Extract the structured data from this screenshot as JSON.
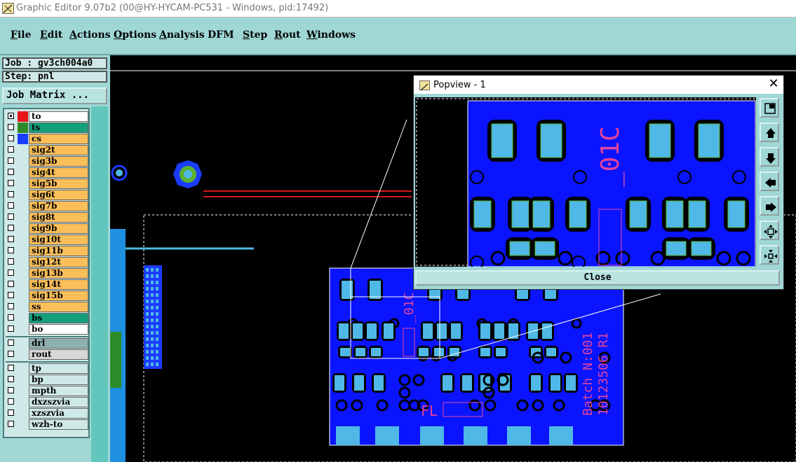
{
  "window": {
    "title": "Graphic Editor 9.07b2 (00@HY-HYCAM-PC531 - Windows, pid:17492)"
  },
  "menu": [
    {
      "label": "File",
      "u": "F",
      "rest": "ile"
    },
    {
      "label": "Edit",
      "u": "E",
      "rest": "dit"
    },
    {
      "label": "Actions",
      "u": "A",
      "rest": "ctions"
    },
    {
      "label": "Options",
      "u": "O",
      "rest": "ptions"
    },
    {
      "label": "Analysis",
      "u": "A",
      "rest": "nalysis"
    },
    {
      "label": "DFM",
      "u": "",
      "rest": "DFM"
    },
    {
      "label": "Step",
      "u": "S",
      "rest": "tep"
    },
    {
      "label": "Rout",
      "u": "R",
      "rest": "out"
    },
    {
      "label": "Windows",
      "u": "W",
      "rest": "indows"
    }
  ],
  "info": {
    "job": "Job : gv3ch004a0",
    "step": "Step: pnl",
    "job_matrix": "Job Matrix ..."
  },
  "layers": [
    {
      "name": "to",
      "color": "#ffffff",
      "swatch": "#e8141a",
      "board": true,
      "on": true
    },
    {
      "name": "ts",
      "color": "#14a07a",
      "swatch": "#2e8b2a",
      "board": true,
      "on": false
    },
    {
      "name": "cs",
      "color": "#fbbf5a",
      "swatch": "#1a3cff",
      "board": true,
      "on": false
    },
    {
      "name": "sig2t",
      "color": "#fbbf5a",
      "board": true,
      "on": false
    },
    {
      "name": "sig3b",
      "color": "#fbbf5a",
      "board": true,
      "on": false
    },
    {
      "name": "sig4t",
      "color": "#fbbf5a",
      "board": true,
      "on": false
    },
    {
      "name": "sig5b",
      "color": "#fbbf5a",
      "board": true,
      "on": false
    },
    {
      "name": "sig6t",
      "color": "#fbbf5a",
      "board": true,
      "on": false
    },
    {
      "name": "sig7b",
      "color": "#fbbf5a",
      "board": true,
      "on": false
    },
    {
      "name": "sig8t",
      "color": "#fbbf5a",
      "board": true,
      "on": false
    },
    {
      "name": "sig9b",
      "color": "#fbbf5a",
      "board": true,
      "on": false
    },
    {
      "name": "sig10t",
      "color": "#fbbf5a",
      "board": true,
      "on": false
    },
    {
      "name": "sig11b",
      "color": "#fbbf5a",
      "board": true,
      "on": false
    },
    {
      "name": "sig12t",
      "color": "#fbbf5a",
      "board": true,
      "on": false
    },
    {
      "name": "sig13b",
      "color": "#fbbf5a",
      "board": true,
      "on": false
    },
    {
      "name": "sig14t",
      "color": "#fbbf5a",
      "board": true,
      "on": false
    },
    {
      "name": "sig15b",
      "color": "#fbbf5a",
      "board": true,
      "on": false
    },
    {
      "name": "ss",
      "color": "#fbbf5a",
      "board": true,
      "on": false
    },
    {
      "name": "bs",
      "color": "#14a07a",
      "board": true,
      "on": false
    },
    {
      "name": "bo",
      "color": "#ffffff",
      "board": true,
      "on": false
    },
    {
      "name": "drl",
      "color": "#8fb0b0",
      "board": false,
      "on": false
    },
    {
      "name": "rout",
      "color": "#d8d8d8",
      "board": false,
      "on": false
    },
    {
      "name": "tp",
      "color": "#cfe9e8",
      "board": false,
      "on": false
    },
    {
      "name": "bp",
      "color": "#cfe9e8",
      "board": false,
      "on": false
    },
    {
      "name": "mpth",
      "color": "#cfe9e8",
      "board": false,
      "on": false
    },
    {
      "name": "dxzszvia",
      "color": "#cfe9e8",
      "board": false,
      "on": false
    },
    {
      "name": "xzszvia",
      "color": "#cfe9e8",
      "board": false,
      "on": false
    },
    {
      "name": "wzh-to",
      "color": "#cfe9e8",
      "board": false,
      "on": false
    }
  ],
  "popview": {
    "title": "Popview - 1",
    "close_label": "Close",
    "text_01c": "_01C",
    "tools": [
      "zoom-home-icon",
      "pan-up-icon",
      "pan-down-icon",
      "pan-left-icon",
      "pan-right-icon",
      "zoom-in-icon",
      "zoom-out-icon"
    ]
  },
  "board": {
    "text_01c": "_01C",
    "text_fl": "FL",
    "batch": "Batch N:001",
    "code": "10123506 R1"
  },
  "colors": {
    "board_blue": "#0a14ff",
    "pad": "#4fb8e6",
    "silk": "#e3439c",
    "panel": "#9fd7d5",
    "red_trace": "#d9181c"
  }
}
